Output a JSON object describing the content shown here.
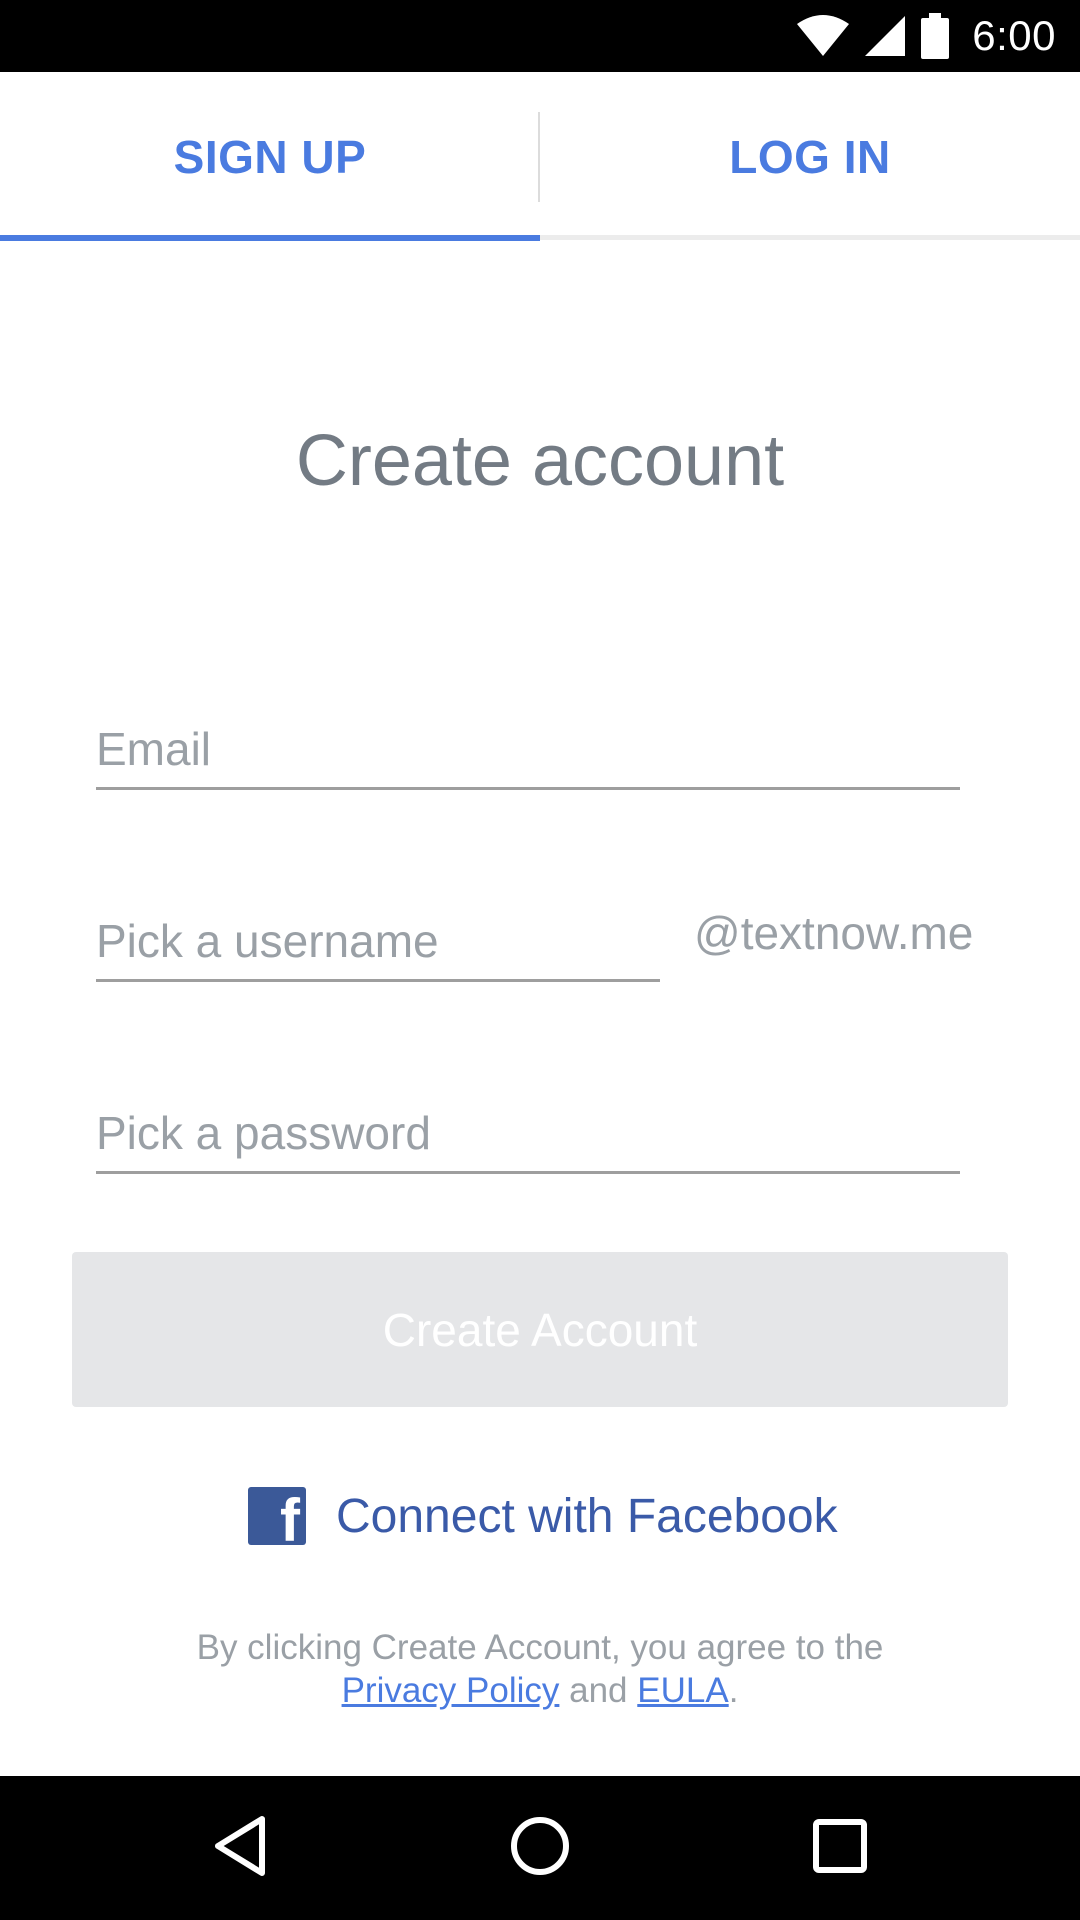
{
  "status_bar": {
    "time": "6:00"
  },
  "tabs": [
    {
      "label": "SIGN UP",
      "active": true
    },
    {
      "label": "LOG IN",
      "active": false
    }
  ],
  "title": "Create account",
  "form": {
    "email_placeholder": "Email",
    "username_placeholder": "Pick a username",
    "username_suffix": "@textnow.me",
    "password_placeholder": "Pick a password",
    "submit_label": "Create Account"
  },
  "facebook": {
    "label": "Connect with Facebook",
    "icon": "facebook-icon"
  },
  "terms": {
    "prefix": "By clicking Create Account, you agree to the",
    "privacy_link": "Privacy Policy",
    "and": "and",
    "eula_link": "EULA",
    "suffix": "."
  },
  "nav_bar": {
    "icons": [
      "back-icon",
      "home-icon",
      "recents-icon"
    ]
  },
  "colors": {
    "accent": "#4a7be0",
    "facebook": "#3b5998",
    "button_disabled": "#e5e6e8"
  }
}
